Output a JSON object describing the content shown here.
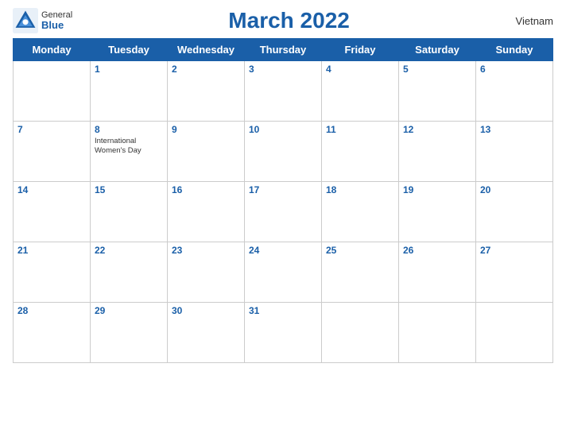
{
  "logo": {
    "general": "General",
    "blue": "Blue"
  },
  "header": {
    "title": "March 2022",
    "country": "Vietnam"
  },
  "weekdays": [
    "Monday",
    "Tuesday",
    "Wednesday",
    "Thursday",
    "Friday",
    "Saturday",
    "Sunday"
  ],
  "weeks": [
    [
      {
        "num": "",
        "empty": true
      },
      {
        "num": "1"
      },
      {
        "num": "2"
      },
      {
        "num": "3"
      },
      {
        "num": "4"
      },
      {
        "num": "5"
      },
      {
        "num": "6"
      }
    ],
    [
      {
        "num": "7"
      },
      {
        "num": "8",
        "event": "International Women's Day"
      },
      {
        "num": "9"
      },
      {
        "num": "10"
      },
      {
        "num": "11"
      },
      {
        "num": "12"
      },
      {
        "num": "13"
      }
    ],
    [
      {
        "num": "14"
      },
      {
        "num": "15"
      },
      {
        "num": "16"
      },
      {
        "num": "17"
      },
      {
        "num": "18"
      },
      {
        "num": "19"
      },
      {
        "num": "20"
      }
    ],
    [
      {
        "num": "21"
      },
      {
        "num": "22"
      },
      {
        "num": "23"
      },
      {
        "num": "24"
      },
      {
        "num": "25"
      },
      {
        "num": "26"
      },
      {
        "num": "27"
      }
    ],
    [
      {
        "num": "28"
      },
      {
        "num": "29"
      },
      {
        "num": "30"
      },
      {
        "num": "31"
      },
      {
        "num": "",
        "empty": true
      },
      {
        "num": "",
        "empty": true
      },
      {
        "num": "",
        "empty": true
      }
    ]
  ]
}
